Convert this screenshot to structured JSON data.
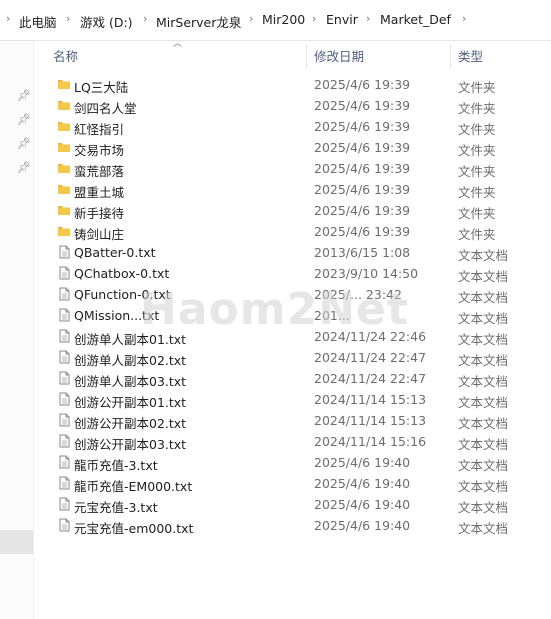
{
  "breadcrumb": {
    "items": [
      "此电脑",
      "游戏 (D:)",
      "MirServer龙泉",
      "Mir200",
      "Envir",
      "Market_Def"
    ]
  },
  "columns": {
    "name": "名称",
    "date": "修改日期",
    "type": "类型"
  },
  "files": [
    {
      "icon": "folder-icon",
      "name": "LQ三大陆",
      "date": "2025/4/6 19:39",
      "type": "文件夹"
    },
    {
      "icon": "folder-icon",
      "name": "剑四名人堂",
      "date": "2025/4/6 19:39",
      "type": "文件夹"
    },
    {
      "icon": "folder-icon",
      "name": "紅怪指引",
      "date": "2025/4/6 19:39",
      "type": "文件夹"
    },
    {
      "icon": "folder-icon",
      "name": "交易市场",
      "date": "2025/4/6 19:39",
      "type": "文件夹"
    },
    {
      "icon": "folder-icon",
      "name": "蛮荒部落",
      "date": "2025/4/6 19:39",
      "type": "文件夹"
    },
    {
      "icon": "folder-icon",
      "name": "盟重土城",
      "date": "2025/4/6 19:39",
      "type": "文件夹"
    },
    {
      "icon": "folder-icon",
      "name": "新手接待",
      "date": "2025/4/6 19:39",
      "type": "文件夹"
    },
    {
      "icon": "folder-icon",
      "name": "铸剑山庄",
      "date": "2025/4/6 19:39",
      "type": "文件夹"
    },
    {
      "icon": "text-file-icon",
      "name": "QBatter-0.txt",
      "date": "2013/6/15 1:08",
      "type": "文本文档"
    },
    {
      "icon": "text-file-icon",
      "name": "QChatbox-0.txt",
      "date": "2023/9/10 14:50",
      "type": "文本文档"
    },
    {
      "icon": "text-file-icon",
      "name": "QFunction-0.txt",
      "date": "2025/... 23:42",
      "type": "文本文档"
    },
    {
      "icon": "text-file-icon",
      "name": "QMission...txt",
      "date": "201...",
      "type": "文本文档"
    },
    {
      "icon": "text-file-icon",
      "name": "创游单人副本01.txt",
      "date": "2024/11/24 22:46",
      "type": "文本文档"
    },
    {
      "icon": "text-file-icon",
      "name": "创游单人副本02.txt",
      "date": "2024/11/24 22:47",
      "type": "文本文档"
    },
    {
      "icon": "text-file-icon",
      "name": "创游单人副本03.txt",
      "date": "2024/11/24 22:47",
      "type": "文本文档"
    },
    {
      "icon": "text-file-icon",
      "name": "创游公开副本01.txt",
      "date": "2024/11/14 15:13",
      "type": "文本文档"
    },
    {
      "icon": "text-file-icon",
      "name": "创游公开副本02.txt",
      "date": "2024/11/14 15:13",
      "type": "文本文档"
    },
    {
      "icon": "text-file-icon",
      "name": "创游公开副本03.txt",
      "date": "2024/11/14 15:16",
      "type": "文本文档"
    },
    {
      "icon": "text-file-icon",
      "name": "龍币充值-3.txt",
      "date": "2025/4/6 19:40",
      "type": "文本文档"
    },
    {
      "icon": "text-file-icon",
      "name": "龍币充值-EM000.txt",
      "date": "2025/4/6 19:40",
      "type": "文本文档"
    },
    {
      "icon": "text-file-icon",
      "name": "元宝充值-3.txt",
      "date": "2025/4/6 19:40",
      "type": "文本文档"
    },
    {
      "icon": "text-file-icon",
      "name": "元宝充值-em000.txt",
      "date": "2025/4/6 19:40",
      "type": "文本文档"
    }
  ],
  "watermark": "Haom2Net",
  "colors": {
    "folder": "#f5c84c",
    "folder_tab": "#e8b53a",
    "header_text": "#4d6082",
    "secondary_text": "#6d6d6d"
  }
}
